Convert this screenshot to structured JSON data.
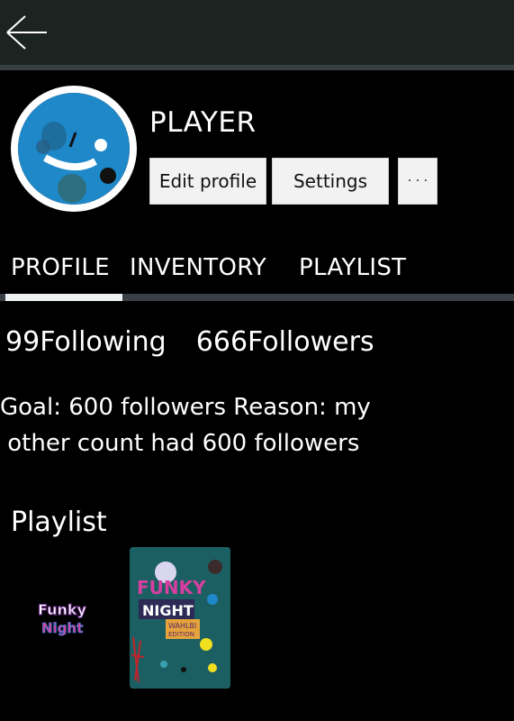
{
  "header": {
    "back_icon": "arrow-left-icon"
  },
  "profile": {
    "username": "PLAYER",
    "avatar_colors": {
      "ring": "#ffffff",
      "face": "#1e88c9"
    }
  },
  "actions": {
    "edit_profile": "Edit profile",
    "settings": "Settings",
    "more": "· · ·"
  },
  "tabs": [
    {
      "label": "PROFILE",
      "active": true
    },
    {
      "label": "INVENTORY",
      "active": false
    },
    {
      "label": "PLAYLIST",
      "active": false
    }
  ],
  "stats": {
    "following_count": "99",
    "following_label": "Following",
    "followers_count": "666",
    "followers_label": "Followers"
  },
  "bio": {
    "line1": "Goal: 600 followers Reason: my",
    "line2": " other count had 600 followers"
  },
  "playlist": {
    "heading": "Playlist",
    "items": [
      {
        "title_top": "Funky",
        "title_bottom": "Night"
      },
      {
        "title_top": "FUNKY",
        "title_bottom": "NIGHT",
        "subtitle_top": "WAHLBI",
        "subtitle_bottom": "EDITION"
      }
    ]
  },
  "colors": {
    "background": "#000000",
    "topbar": "#1c2422",
    "accent_pink": "#d63fa0",
    "tile_teal": "#1c5f63"
  }
}
